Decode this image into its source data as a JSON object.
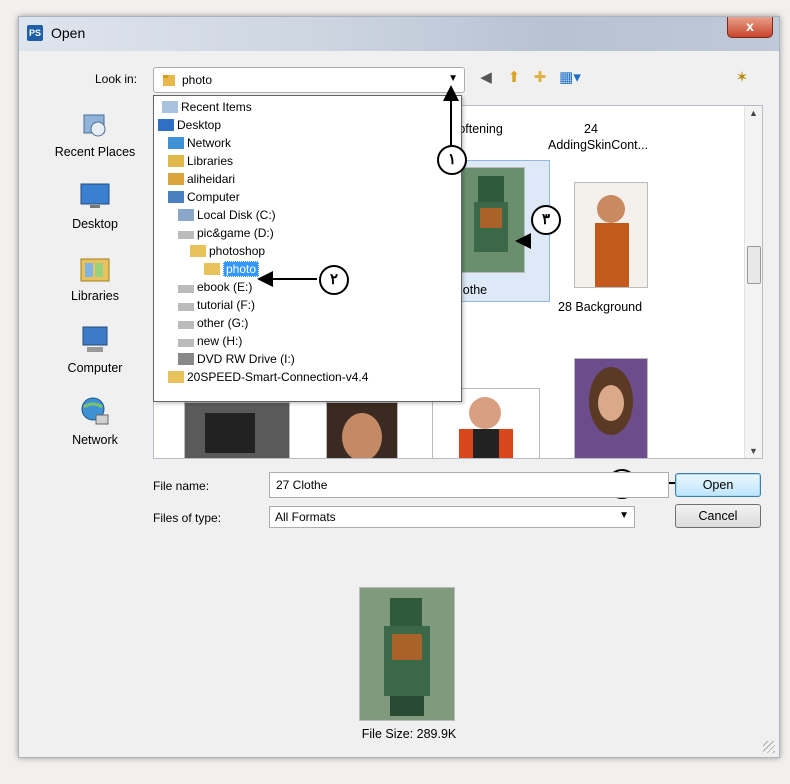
{
  "window": {
    "app_icon": "PS",
    "title": "Open",
    "close_label": "x"
  },
  "look_in": {
    "label": "Look in:",
    "value": "photo"
  },
  "places": [
    {
      "label": "Recent Places",
      "icon": "recent-places-icon"
    },
    {
      "label": "Desktop",
      "icon": "desktop-icon"
    },
    {
      "label": "Libraries",
      "icon": "libraries-icon"
    },
    {
      "label": "Computer",
      "icon": "computer-icon"
    },
    {
      "label": "Network",
      "icon": "network-icon"
    }
  ],
  "dropdown_items": [
    "Recent Items",
    "Desktop",
    "Network",
    "Libraries",
    "aliheidari",
    "Computer",
    "Local Disk (C:)",
    "pic&game (D:)",
    "photoshop",
    "photo",
    "ebook (E:)",
    "tutorial (F:)",
    "other (G:)",
    "new (H:)",
    "DVD RW Drive (I:)",
    "20SPEED-Smart-Connection-v4.4"
  ],
  "files": {
    "top_labels": [
      "Softening",
      "24",
      "AddingSkinCont..."
    ],
    "clothe_label": "Clothe",
    "background_label": "28 Background"
  },
  "callouts": [
    "١",
    "٢",
    "٣",
    "۴"
  ],
  "file_name": {
    "label": "File name:",
    "value": "27 Clothe"
  },
  "file_type": {
    "label": "Files of type:",
    "value": "All Formats"
  },
  "buttons": {
    "open": "Open",
    "cancel": "Cancel"
  },
  "preview": {
    "file_size": "File Size: 289.9K"
  },
  "colors": {
    "selection": "#3399ff",
    "title_gradient": "#b7c2d2",
    "close_red": "#c8452d"
  }
}
